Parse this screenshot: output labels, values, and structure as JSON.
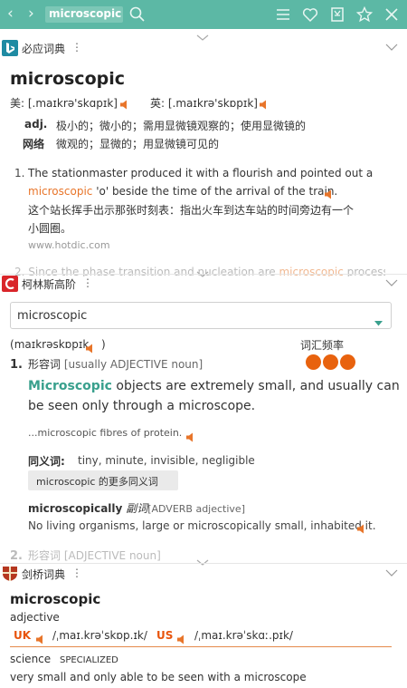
{
  "toolbar": {
    "back_glyph": "‹",
    "forward_glyph": "›",
    "query": "microscopic",
    "icons": [
      "search-icon",
      "menu-icon",
      "heart-icon",
      "bookmark-icon",
      "star-icon",
      "close-icon"
    ]
  },
  "bing": {
    "name": "必应词典",
    "headword": "microscopic",
    "pron_us_label": "美:",
    "pron_us": "[.maɪkrə'skɑpɪk]",
    "pron_uk_label": "英:",
    "pron_uk": "[.maɪkrə'skɒpɪk]",
    "defs": [
      {
        "pos": "adj.",
        "text": "极小的；微小的；需用显微镜观察的；使用显微镜的"
      },
      {
        "pos": "网络",
        "text": "微观的；显微的；用显微镜可见的"
      }
    ],
    "example1": {
      "num": "1.",
      "line1": "The stationmaster produced it with a flourish and pointed out a",
      "highlight": "microscopic",
      "line2_rest": " 'o' beside the time of the arrival of the train.",
      "cn_line1": "这个站长挥手出示那张时刻表：指出火车到达车站的时间旁边有一个",
      "cn_line2": "小圆圈。",
      "source": "www.hotdic.com"
    },
    "example2": {
      "num": "2.",
      "text_before": "Since the phase transition and nucleation are ",
      "highlight": "microscopic",
      "text_after": " processes,"
    }
  },
  "collins": {
    "name": "柯林斯高阶",
    "dropdown_value": "microscopic",
    "pron_open": "(",
    "pron": "maɪkrəskɒpɪk",
    "pron_close": ")",
    "freq_label": "词汇频率",
    "freq_level": 3,
    "sense1": {
      "num": "1.",
      "pos_cn": "形容词",
      "pos_en": "[usually ADJECTIVE noun]",
      "def_word": "Microscopic",
      "def_line1": " objects are extremely small, and usually can",
      "def_line2": "be seen only through a microscope.",
      "example": "...microscopic fibres of protein.",
      "syn_label": "同义词:",
      "syn_words": "tiny,  minute,  invisible,  negligible",
      "syn_more": "microscopic 的更多同义词",
      "deriv_word": "microscopically",
      "deriv_pos_cn": "副词",
      "deriv_pos_en": "[ADVERB adjective]",
      "deriv_example": "No living organisms, large or microscopically small, inhabited it."
    },
    "sense2": {
      "num": "2.",
      "pos_cn": "形容词",
      "pos_en": "[ADJECTIVE noun]"
    }
  },
  "cambridge": {
    "name": "剑桥词典",
    "headword": "microscopic",
    "pos": "adjective",
    "uk_label": "UK",
    "uk_pron": "/ˌmaɪ.krəˈskɒp.ɪk/",
    "us_label": "US",
    "us_pron": "/ˌmaɪ.krəˈskɑː.pɪk/",
    "domain": "science",
    "domain_tag": "SPECIALIZED",
    "definition": "very small and only able to be seen with a microscope"
  },
  "colors": {
    "accent": "#5cb8a5",
    "orange": "#e8752a",
    "teal": "#39a08d",
    "dot": "#e8620e"
  }
}
